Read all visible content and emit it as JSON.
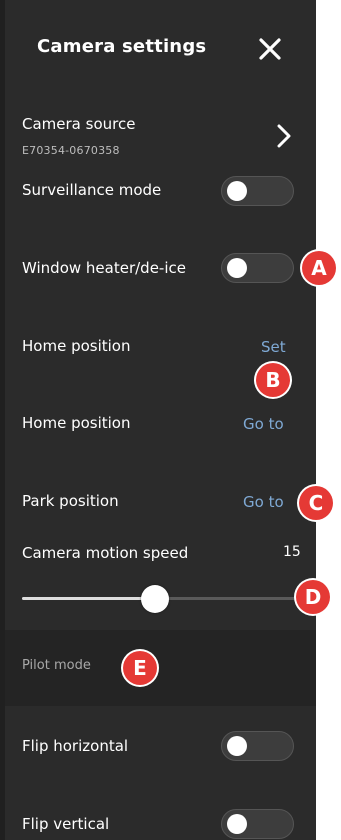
{
  "header": {
    "title": "Camera settings",
    "close_icon": "close-icon"
  },
  "camera_source": {
    "label": "Camera source",
    "id": "E70354-0670358",
    "icon": "chevron-right-icon"
  },
  "surveillance_mode": {
    "label": "Surveillance mode",
    "on": false
  },
  "window_heater": {
    "label": "Window heater/de-ice",
    "on": false
  },
  "home_set": {
    "label": "Home position",
    "action": "Set"
  },
  "home_goto": {
    "label": "Home position",
    "action": "Go to"
  },
  "park": {
    "label": "Park position",
    "action": "Go to"
  },
  "motion_speed": {
    "label": "Camera motion speed",
    "value": "15",
    "fraction": 0.47
  },
  "pilot_mode": {
    "section_label": "Pilot mode"
  },
  "flip_horizontal": {
    "label": "Flip horizontal",
    "on": false
  },
  "flip_vertical": {
    "label": "Flip vertical",
    "on": false
  },
  "callouts": [
    "A",
    "B",
    "C",
    "D",
    "E"
  ],
  "colors": {
    "panel": "#2b2b2b",
    "link": "#7fa9d4",
    "callout": "#e53935"
  }
}
